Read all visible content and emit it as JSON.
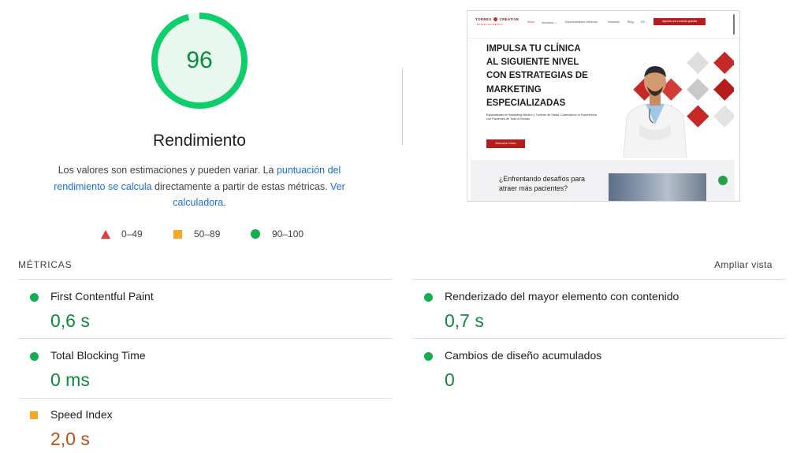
{
  "score": {
    "value": "96",
    "fraction": 0.96,
    "color": "#0a8a3c"
  },
  "title": "Rendimiento",
  "description": {
    "part1": "Los valores son estimaciones y pueden variar. La ",
    "link1": "puntuación del rendimiento se calcula",
    "part2": " directamente a partir de estas métricas. ",
    "link2": "Ver calculadora",
    "part3": "."
  },
  "legend": [
    {
      "label": "0–49",
      "shape": "triangle",
      "color": "#e53935"
    },
    {
      "label": "50–89",
      "shape": "square",
      "color": "#f9a825"
    },
    {
      "label": "90–100",
      "shape": "circle",
      "color": "#11b04f"
    }
  ],
  "preview": {
    "brand": "TORRES",
    "brand2": "CREATIVE",
    "brand_sub": "MARKETING MÉDICO",
    "nav": [
      "Inicio",
      "Servicios ⌄",
      "Especialidades Médicas",
      "Nosotros",
      "Blog",
      "ES"
    ],
    "nav_cta": "Agenda una consulta gratuita",
    "headline": [
      "IMPULSA TU CLÍNICA",
      "AL SIGUIENTE NIVEL",
      "CON ESTRATEGIAS DE",
      "MARKETING",
      "ESPECIALIZADAS"
    ],
    "subtext": "Especialistas en Marketing Médico y Turismo de Salud. Conectando tu Experiencia con Pacientes de Todo el Mundo",
    "button": "Descubre Cómo",
    "section_title": [
      "¿Enfrentando desafíos para",
      "atraer más pacientes?"
    ]
  },
  "metrics_heading": "MÉTRICAS",
  "expand_label": "Ampliar vista",
  "metrics": [
    {
      "label": "First Contentful Paint",
      "value": "0,6 s",
      "status": "good"
    },
    {
      "label": "Renderizado del mayor elemento con contenido",
      "value": "0,7 s",
      "status": "good"
    },
    {
      "label": "Total Blocking Time",
      "value": "0 ms",
      "status": "good"
    },
    {
      "label": "Cambios de diseño acumulados",
      "value": "0",
      "status": "good"
    },
    {
      "label": "Speed Index",
      "value": "2,0 s",
      "status": "average"
    }
  ],
  "colors": {
    "good": "#0a8a3c",
    "average": "#c24b12",
    "link": "#1a6ed6",
    "gauge_fill": "#e8f8ee",
    "gauge_ring": "#0cce6b"
  }
}
